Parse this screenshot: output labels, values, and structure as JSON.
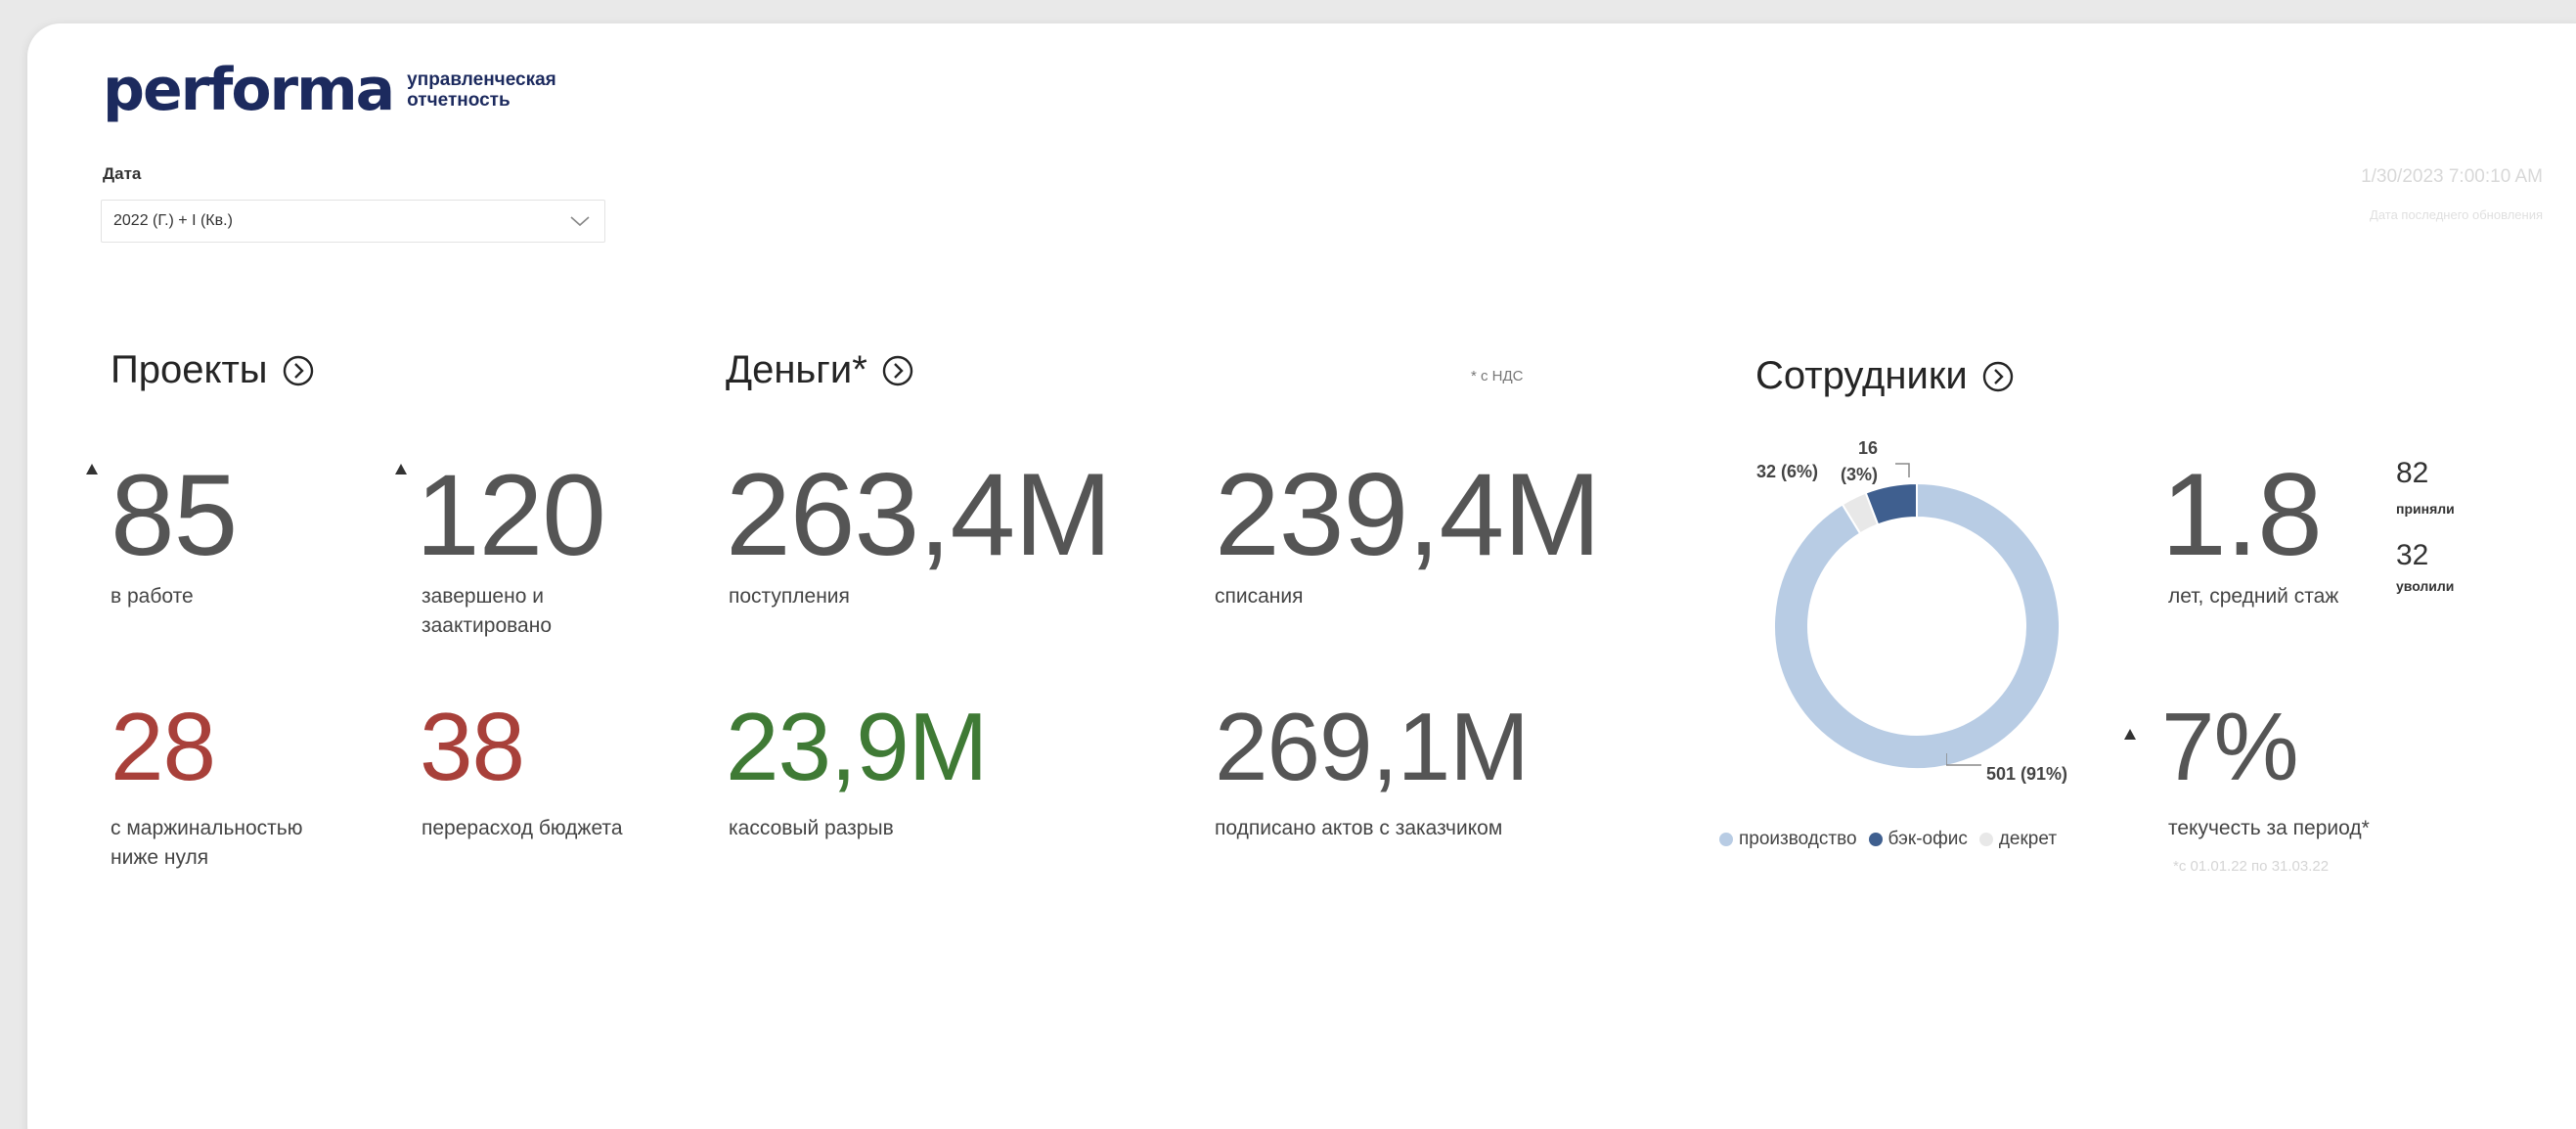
{
  "header": {
    "logo_text": "performa",
    "logo_subtitle_line1": "управленческая",
    "logo_subtitle_line2": "отчетность",
    "refresh_time": "1/30/2023 7:00:10 AM",
    "refresh_note": "Дата последнего обновления"
  },
  "filter": {
    "label": "Дата",
    "value": "2022 (Г.) + I (Кв.)"
  },
  "projects": {
    "title": "Проекты",
    "in_work_value": "85",
    "in_work_label": "в работе",
    "completed_value": "120",
    "completed_label_1": "завершено и",
    "completed_label_2": "заактировано",
    "negative_margin_value": "28",
    "negative_margin_label_1": "с маржинальностью",
    "negative_margin_label_2": "ниже нуля",
    "overbudget_value": "38",
    "overbudget_label": "перерасход бюджета"
  },
  "money": {
    "title": "Деньги*",
    "nds_note": "* с НДС",
    "income_value": "263,4M",
    "income_label": "поступления",
    "expense_value": "239,4M",
    "expense_label": "списания",
    "cash_gap_value": "23,9M",
    "cash_gap_label": "кассовый разрыв",
    "acts_value": "269,1M",
    "acts_label": "подписано актов с заказчиком"
  },
  "employees": {
    "title": "Сотрудники",
    "donut": {
      "label_production": "501 (91%)",
      "label_backoffice": "32 (6%)",
      "label_maternity_value": "16",
      "label_maternity_pct": "(3%)"
    },
    "legend": {
      "production": "производство",
      "backoffice": "бэк-офис",
      "maternity": "декрет"
    },
    "tenure_value": "1.8",
    "tenure_label": "лет, средний стаж",
    "hired_value": "82",
    "hired_label": "приняли",
    "fired_value": "32",
    "fired_label": "уволили",
    "turnover_value": "7%",
    "turnover_label": "текучесть за период*",
    "period_note": "*с 01.01.22 по 31.03.22"
  },
  "chart_data": {
    "type": "pie",
    "categories": [
      "производство",
      "бэк-офис",
      "декрет"
    ],
    "values": [
      501,
      32,
      16
    ],
    "percents": [
      91,
      6,
      3
    ],
    "colors": [
      "#b8cce4",
      "#3f5f8f",
      "#e8e8e8"
    ],
    "legend": "bottom"
  },
  "colors": {
    "logo": "#1c2a5e",
    "negative": "#a8403a",
    "positive": "#3f7a35",
    "neutral": "#555555"
  }
}
